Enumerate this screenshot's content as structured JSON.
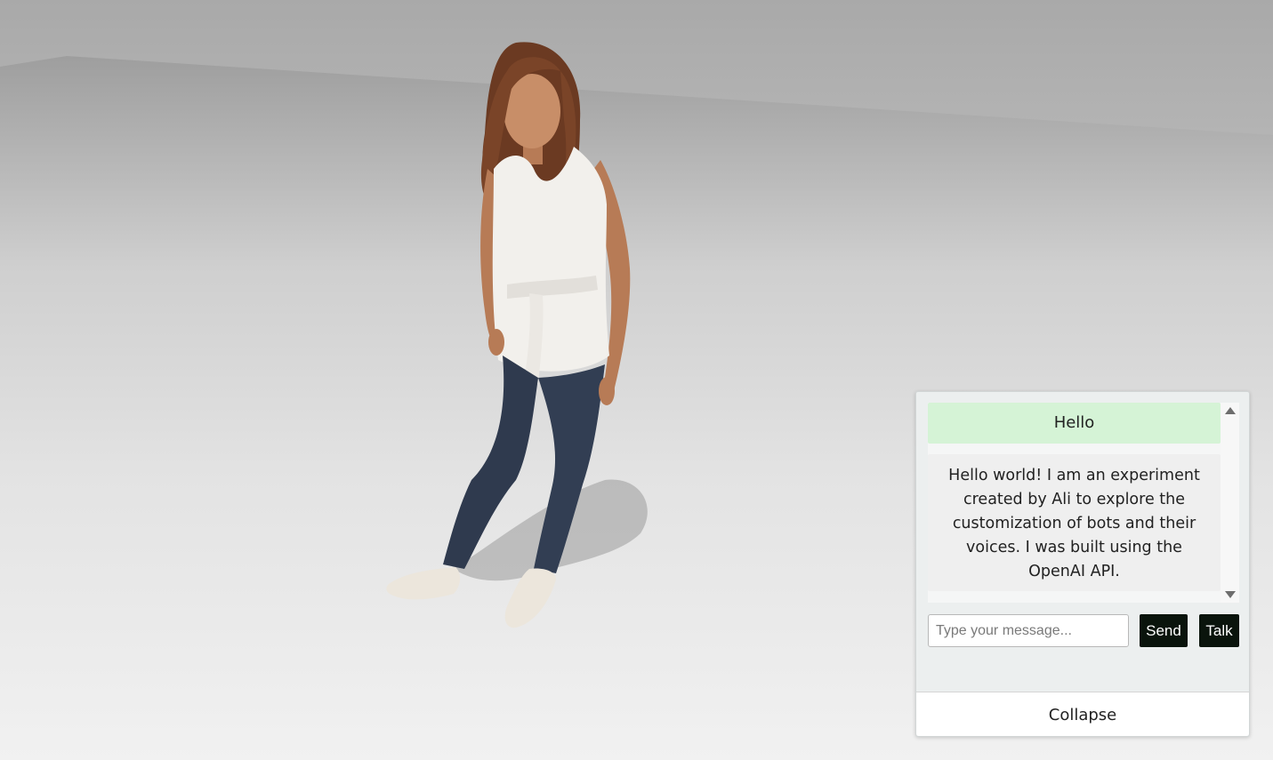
{
  "scene": {
    "background_top": "#a8a8a8",
    "background_bottom": "#f1f1f1"
  },
  "chat": {
    "messages": [
      {
        "role": "user",
        "text": "Hello",
        "color": "#d5f3d6"
      },
      {
        "role": "bot",
        "text": "Hello world! I am an experiment created by Ali to explore the customization of bots and their voices. I was built using the OpenAI API.",
        "color": "#efefef"
      }
    ],
    "input": {
      "placeholder": "Type your message...",
      "value": ""
    },
    "send_label": "Send",
    "talk_label": "Talk",
    "collapse_label": "Collapse",
    "button_color": "#0a140c"
  }
}
